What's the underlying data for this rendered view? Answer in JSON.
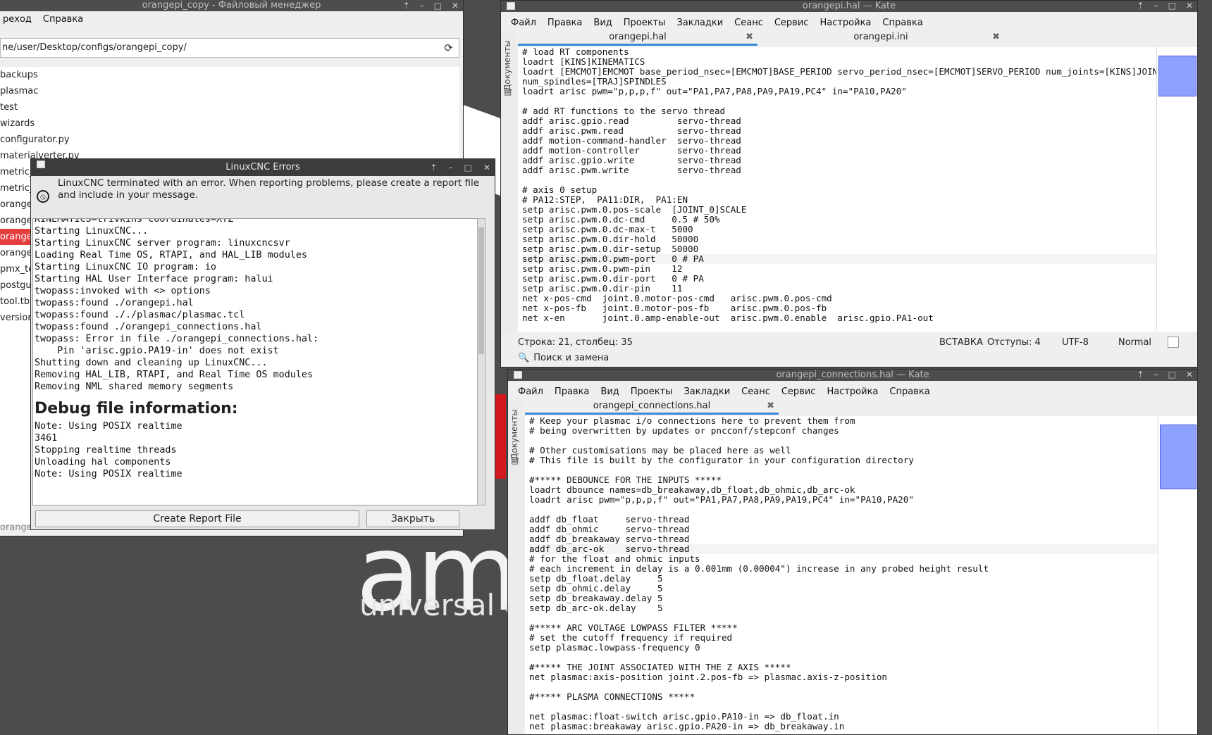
{
  "wallpaper": {
    "logo": "am",
    "subtitle": "universal o"
  },
  "file_manager": {
    "title": "orangepi_copy - Файловый менеджер",
    "menu": [
      "реход",
      "Справка"
    ],
    "path": "ne/user/Desktop/configs/orangepi_copy/",
    "items": [
      "backups",
      "plasmac",
      "test",
      "wizards",
      "configurator.py",
      "materialverter.py",
      "metric_",
      "metric_",
      "orange",
      "orange",
      "orange",
      "orange",
      "pmx_te",
      "postgui",
      "tool.tbl",
      "version"
    ],
    "selected_index": 10,
    "status": "orange"
  },
  "errors_dialog": {
    "title": "LinuxCNC Errors",
    "message": "LinuxCNC terminated with an error.  When reporting problems, please create a report file and include in your message.",
    "log": [
      "KINEMATICS=trivkins coordinates=XYZ",
      "Starting LinuxCNC...",
      "Starting LinuxCNC server program: linuxcncsvr",
      "Loading Real Time OS, RTAPI, and HAL_LIB modules",
      "Starting LinuxCNC IO program: io",
      "Starting HAL User Interface program: halui",
      "twopass:invoked with <> options",
      "twopass:found ./orangepi.hal",
      "twopass:found ././plasmac/plasmac.tcl",
      "twopass:found ./orangepi_connections.hal",
      "twopass: Error in file ./orangepi_connections.hal:",
      "    Pin 'arisc.gpio.PA19-in' does not exist",
      "Shutting down and cleaning up LinuxCNC...",
      "Removing HAL_LIB, RTAPI, and Real Time OS modules",
      "Removing NML shared memory segments"
    ],
    "debug_heading": "Debug file information:",
    "debug_log": [
      "Note: Using POSIX realtime",
      "3461",
      "Stopping realtime threads",
      "Unloading hal components",
      "Note: Using POSIX realtime"
    ],
    "create_report_label": "Create Report File",
    "close_label": "Закрыть"
  },
  "kate1": {
    "title": "orangepi.hal  — Kate",
    "menu": [
      "Файл",
      "Правка",
      "Вид",
      "Проекты",
      "Закладки",
      "Сеанс",
      "Сервис",
      "Настройка",
      "Справка"
    ],
    "tabs": [
      "orangepi.hal",
      "orangepi.ini"
    ],
    "side_label": "Документы",
    "code": [
      "# load RT components",
      "loadrt [KINS]KINEMATICS",
      "loadrt [EMCMOT]EMCMOT base_period_nsec=[EMCMOT]BASE_PERIOD servo_period_nsec=[EMCMOT]SERVO_PERIOD num_joints=[KINS]JOINTS",
      "num_spindles=[TRAJ]SPINDLES",
      "loadrt arisc pwm=\"p,p,p,f\" out=\"PA1,PA7,PA8,PA9,PA19,PC4\" in=\"PA10,PA20\"",
      "",
      "# add RT functions to the servo thread",
      "addf arisc.gpio.read         servo-thread",
      "addf arisc.pwm.read          servo-thread",
      "addf motion-command-handler  servo-thread",
      "addf motion-controller       servo-thread",
      "addf arisc.gpio.write        servo-thread",
      "addf arisc.pwm.write         servo-thread",
      "",
      "# axis 0 setup",
      "# PA12:STEP,  PA11:DIR,  PA1:EN",
      "setp arisc.pwm.0.pos-scale  [JOINT_0]SCALE",
      "setp arisc.pwm.0.dc-cmd     0.5 # 50%",
      "setp arisc.pwm.0.dc-max-t   5000",
      "setp arisc.pwm.0.dir-hold   50000",
      "setp arisc.pwm.0.dir-setup  50000",
      "setp arisc.pwm.0.pwm-port   0 # PA",
      "setp arisc.pwm.0.pwm-pin    12",
      "setp arisc.pwm.0.dir-port   0 # PA",
      "setp arisc.pwm.0.dir-pin    11",
      "net x-pos-cmd  joint.0.motor-pos-cmd   arisc.pwm.0.pos-cmd",
      "net x-pos-fb   joint.0.motor-pos-fb    arisc.pwm.0.pos-fb",
      "net x-en       joint.0.amp-enable-out  arisc.pwm.0.enable  arisc.gpio.PA1-out"
    ],
    "current_line_index": 21,
    "status_position": "Строка: 21, столбец: 35",
    "status_mode": "ВСТАВКА",
    "status_indent": "Отступы: 4",
    "status_encoding": "UTF-8",
    "status_syntax": "Normal",
    "search_replace_label": "Поиск и замена"
  },
  "kate2": {
    "title": "orangepi_connections.hal  — Kate",
    "menu": [
      "Файл",
      "Правка",
      "Вид",
      "Проекты",
      "Закладки",
      "Сеанс",
      "Сервис",
      "Настройка",
      "Справка"
    ],
    "tabs": [
      "orangepi_connections.hal"
    ],
    "side_label": "Документы",
    "code": [
      "# Keep your plasmac i/o connections here to prevent them from",
      "# being overwritten by updates or pncconf/stepconf changes",
      "",
      "# Other customisations may be placed here as well",
      "# This file is built by the configurator in your configuration directory",
      "",
      "#***** DEBOUNCE FOR THE INPUTS *****",
      "loadrt dbounce names=db_breakaway,db_float,db_ohmic,db_arc-ok",
      "loadrt arisc pwm=\"p,p,p,f\" out=\"PA1,PA7,PA8,PA9,PA19,PC4\" in=\"PA10,PA20\"",
      "",
      "addf db_float     servo-thread",
      "addf db_ohmic     servo-thread",
      "addf db_breakaway servo-thread",
      "addf db_arc-ok    servo-thread",
      "# for the float and ohmic inputs",
      "# each increment in delay is a 0.001mm (0.00004\") increase in any probed height result",
      "setp db_float.delay     5",
      "setp db_ohmic.delay     5",
      "setp db_breakaway.delay 5",
      "setp db_arc-ok.delay    5",
      "",
      "#***** ARC VOLTAGE LOWPASS FILTER *****",
      "# set the cutoff frequency if required",
      "setp plasmac.lowpass-frequency 0",
      "",
      "#***** THE JOINT ASSOCIATED WITH THE Z AXIS *****",
      "net plasmac:axis-position joint.2.pos-fb => plasmac.axis-z-position",
      "",
      "#***** PLASMA CONNECTIONS *****",
      "",
      "net plasmac:float-switch arisc.gpio.PA10-in => db_float.in",
      "net plasmac:breakaway arisc.gpio.PA20-in => db_breakaway.in"
    ],
    "current_line_index": 13
  }
}
